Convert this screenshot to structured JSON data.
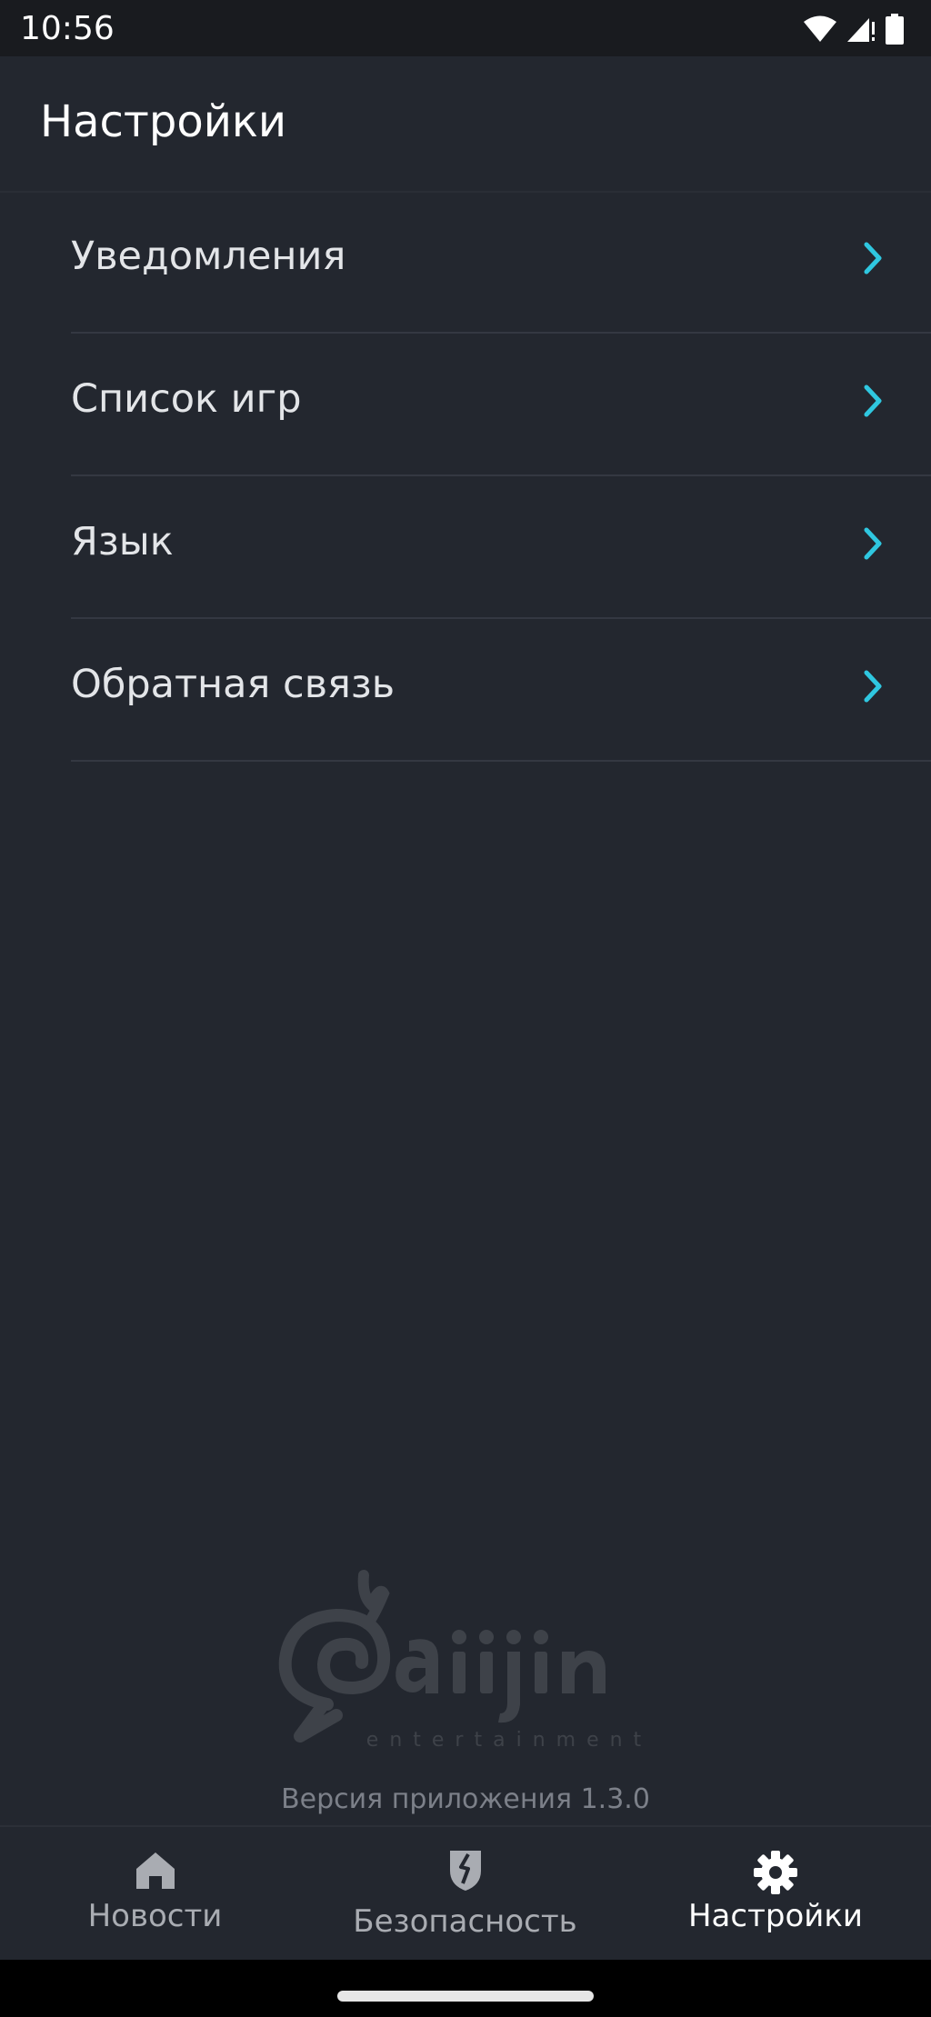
{
  "status_bar": {
    "time": "10:56"
  },
  "header": {
    "title": "Настройки"
  },
  "settings": {
    "items": [
      {
        "label": "Уведомления"
      },
      {
        "label": "Список игр"
      },
      {
        "label": "Язык"
      },
      {
        "label": "Обратная связь"
      }
    ]
  },
  "footer": {
    "logo_text": "Gaijin",
    "logo_subtext": "entertainment",
    "version": "Версия приложения 1.3.0"
  },
  "bottom_nav": {
    "items": [
      {
        "label": "Новости",
        "icon": "home-icon",
        "active": false
      },
      {
        "label": "Безопасность",
        "icon": "shield-icon",
        "active": false
      },
      {
        "label": "Настройки",
        "icon": "gear-icon",
        "active": true
      }
    ]
  },
  "colors": {
    "background": "#23272f",
    "status_bar": "#191b1f",
    "accent": "#2fc7e0",
    "text_primary": "#e3e5e8",
    "text_inactive": "#a9acb2",
    "divider": "#343842"
  }
}
